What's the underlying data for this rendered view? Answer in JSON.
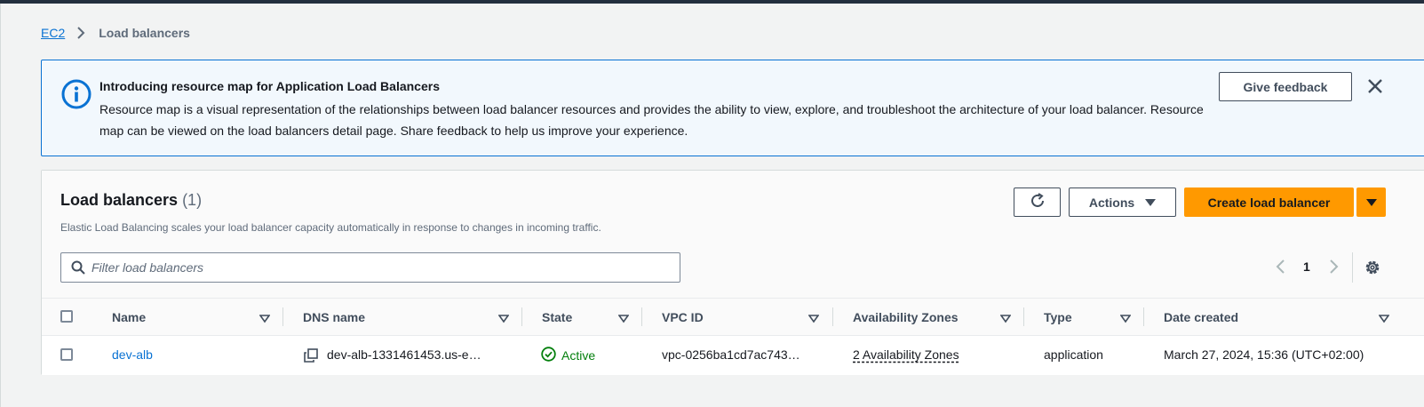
{
  "breadcrumb": {
    "root": "EC2",
    "current": "Load balancers"
  },
  "flash": {
    "title": "Introducing resource map for Application Load Balancers",
    "body": "Resource map is a visual representation of the relationships between load balancer resources and provides the ability to view, explore, and troubleshoot the architecture of your load balancer. Resource map can be viewed on the load balancers detail page. Share feedback to help us improve your experience.",
    "feedback_label": "Give feedback",
    "icon": "info-icon",
    "close_icon": "close-icon"
  },
  "panel": {
    "title": "Load balancers",
    "count": "(1)",
    "description": "Elastic Load Balancing scales your load balancer capacity automatically in response to changes in incoming traffic.",
    "actions_label": "Actions",
    "create_label": "Create load balancer",
    "filter_placeholder": "Filter load balancers",
    "page": "1"
  },
  "table": {
    "columns": [
      "Name",
      "DNS name",
      "State",
      "VPC ID",
      "Availability Zones",
      "Type",
      "Date created"
    ],
    "rows": [
      {
        "name": "dev-alb",
        "dns": "dev-alb-1331461453.us-e…",
        "state": "Active",
        "vpc": "vpc-0256ba1cd7ac743…",
        "zones": "2 Availability Zones",
        "type": "application",
        "created": "March 27, 2024, 15:36 (UTC+02:00)"
      }
    ]
  },
  "colors": {
    "accent": "#0972d3",
    "primary_button": "#ff9900",
    "success": "#037f0c",
    "flash_bg": "#f2f8fd"
  }
}
